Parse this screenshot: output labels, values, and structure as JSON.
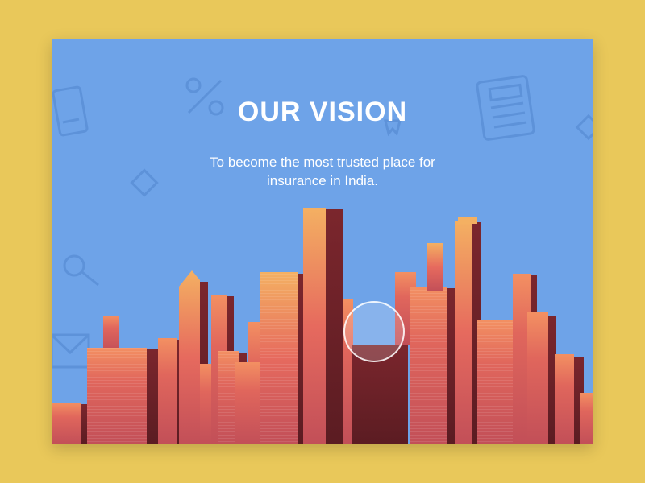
{
  "page": {
    "background_color": "#e9c85a",
    "card_color": "#6ea3e8"
  },
  "hero": {
    "title": "OUR VISION",
    "line1": "To become the most trusted place for",
    "line2": "insurance in India."
  },
  "icons": [
    "percent-icon",
    "document-icon",
    "calculator-icon",
    "badge-icon",
    "diamond-icon",
    "key-icon",
    "envelope-icon"
  ],
  "colors": {
    "building_shadow": "#6e2429",
    "building_light": "#e86a5c",
    "building_glow": "#f0a060",
    "sky": "#6ea3e8"
  }
}
